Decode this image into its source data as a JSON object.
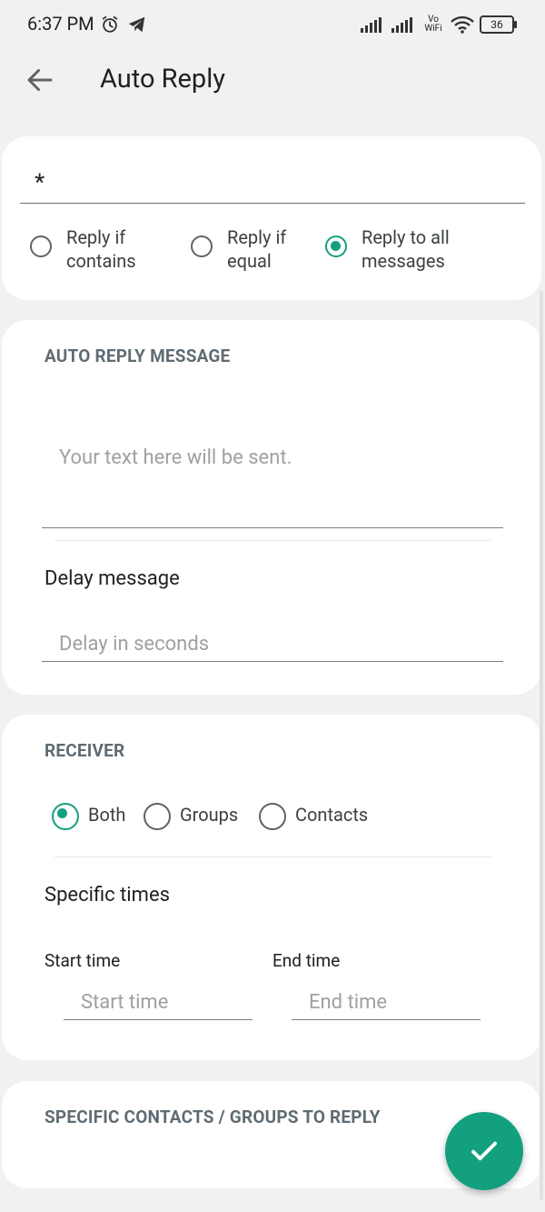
{
  "status_bar": {
    "time": "6:37 PM",
    "network": "Vo WiFi",
    "battery": "36",
    "icons": [
      "alarm-icon",
      "telegram-icon",
      "signal-icon",
      "signal-icon",
      "wifi-icon",
      "battery-icon"
    ]
  },
  "app_bar": {
    "back_icon": "arrow-left-icon",
    "title": "Auto Reply"
  },
  "keyword_card": {
    "keyword_value": "*",
    "options": [
      {
        "label_line1": "Reply if",
        "label_line2": "contains",
        "selected": false
      },
      {
        "label_line1": "Reply if",
        "label_line2": "equal",
        "selected": false
      },
      {
        "label_line1": "Reply to all",
        "label_line2": "messages",
        "selected": true
      }
    ]
  },
  "message_card": {
    "section_title": "AUTO REPLY MESSAGE",
    "message_placeholder": "Your text here will be sent.",
    "delay_label": "Delay message",
    "delay_placeholder": "Delay in seconds"
  },
  "receiver_card": {
    "section_title": "RECEIVER",
    "options": [
      {
        "label": "Both",
        "selected": true
      },
      {
        "label": "Groups",
        "selected": false
      },
      {
        "label": "Contacts",
        "selected": false
      }
    ],
    "specific_times_label": "Specific times",
    "start_time_label": "Start time",
    "start_time_placeholder": "Start time",
    "end_time_label": "End time",
    "end_time_placeholder": "End time"
  },
  "contacts_card": {
    "section_title": "SPECIFIC CONTACTS / GROUPS TO REPLY"
  },
  "fab": {
    "icon": "check-icon"
  },
  "colors": {
    "accent": "#13a07f",
    "background": "#f1f1f1",
    "card": "#ffffff",
    "section_title": "#5f6b73"
  }
}
